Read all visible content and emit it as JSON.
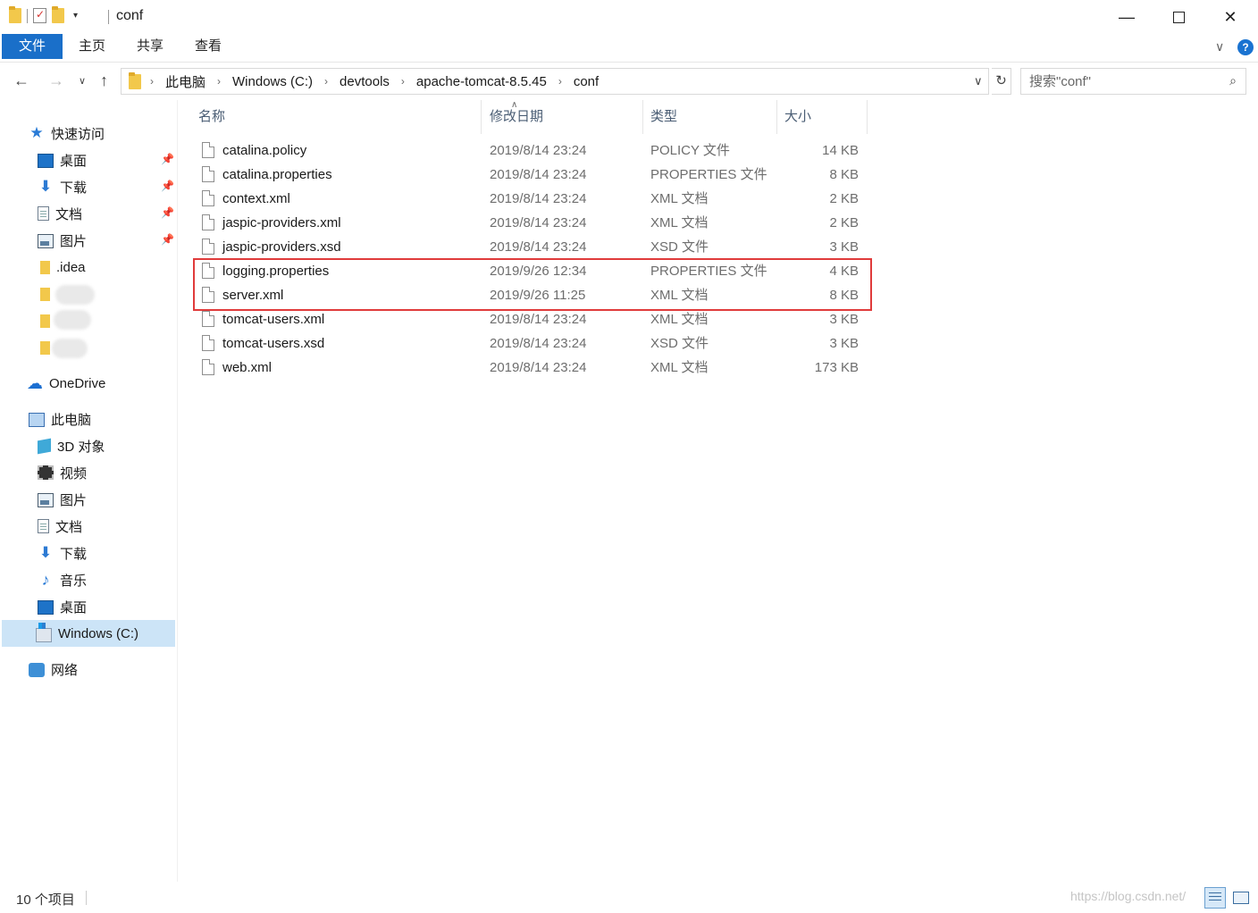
{
  "window": {
    "title": "conf",
    "minimize_glyph": "—",
    "close_glyph": "✕",
    "qat_dropdown_glyph": "▾"
  },
  "ribbon": {
    "tabs": [
      "文件",
      "主页",
      "共享",
      "查看"
    ],
    "expand_glyph": "∨",
    "help_glyph": "?"
  },
  "address": {
    "breadcrumbs": [
      "此电脑",
      "Windows (C:)",
      "devtools",
      "apache-tomcat-8.5.45",
      "conf"
    ],
    "separator": "›",
    "search_placeholder": "搜索\"conf\""
  },
  "sidebar": {
    "quick_access": "快速访问",
    "pinned": [
      "桌面",
      "下载",
      "文档",
      "图片"
    ],
    "folders": [
      ".idea"
    ],
    "onedrive": "OneDrive",
    "this_pc": "此电脑",
    "pc_items": [
      "3D 对象",
      "视频",
      "图片",
      "文档",
      "下载",
      "音乐",
      "桌面",
      "Windows (C:)"
    ],
    "network": "网络"
  },
  "columns": {
    "name": "名称",
    "date": "修改日期",
    "type": "类型",
    "size": "大小"
  },
  "files": [
    {
      "name": "catalina.policy",
      "date": "2019/8/14 23:24",
      "type": "POLICY 文件",
      "size": "14 KB"
    },
    {
      "name": "catalina.properties",
      "date": "2019/8/14 23:24",
      "type": "PROPERTIES 文件",
      "size": "8 KB"
    },
    {
      "name": "context.xml",
      "date": "2019/8/14 23:24",
      "type": "XML 文档",
      "size": "2 KB"
    },
    {
      "name": "jaspic-providers.xml",
      "date": "2019/8/14 23:24",
      "type": "XML 文档",
      "size": "2 KB"
    },
    {
      "name": "jaspic-providers.xsd",
      "date": "2019/8/14 23:24",
      "type": "XSD 文件",
      "size": "3 KB"
    },
    {
      "name": "logging.properties",
      "date": "2019/9/26 12:34",
      "type": "PROPERTIES 文件",
      "size": "4 KB"
    },
    {
      "name": "server.xml",
      "date": "2019/9/26 11:25",
      "type": "XML 文档",
      "size": "8 KB"
    },
    {
      "name": "tomcat-users.xml",
      "date": "2019/8/14 23:24",
      "type": "XML 文档",
      "size": "3 KB"
    },
    {
      "name": "tomcat-users.xsd",
      "date": "2019/8/14 23:24",
      "type": "XSD 文件",
      "size": "3 KB"
    },
    {
      "name": "web.xml",
      "date": "2019/8/14 23:24",
      "type": "XML 文档",
      "size": "173 KB"
    }
  ],
  "status": {
    "item_count": "10 个项目",
    "watermark": "https://blog.csdn.net/"
  },
  "colors": {
    "accent": "#1a6fc9",
    "highlight_box": "#e03b3b",
    "selected_nav": "#cce4f7"
  }
}
